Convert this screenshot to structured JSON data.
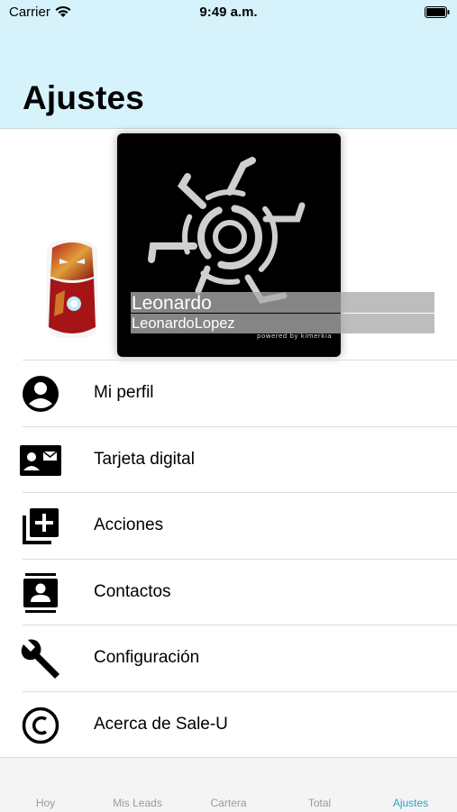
{
  "status_bar": {
    "carrier": "Carrier",
    "time": "9:49 a.m."
  },
  "header": {
    "title": "Ajustes"
  },
  "profile": {
    "name": "Leonardo",
    "username": "LeonardoLopez",
    "cover_caption": "powered by kimerkia"
  },
  "menu": {
    "items": [
      {
        "label": "Mi perfil",
        "icon": "person-circle-icon"
      },
      {
        "label": "Tarjeta digital",
        "icon": "contact-card-icon"
      },
      {
        "label": "Acciones",
        "icon": "add-box-icon"
      },
      {
        "label": "Contactos",
        "icon": "contacts-icon"
      },
      {
        "label": "Configuración",
        "icon": "wrench-icon"
      },
      {
        "label": "Acerca de Sale-U",
        "icon": "copyright-icon"
      }
    ]
  },
  "tab_bar": {
    "tabs": [
      {
        "label": "Hoy"
      },
      {
        "label": "Mis Leads"
      },
      {
        "label": "Cartera"
      },
      {
        "label": "Total"
      },
      {
        "label": "Ajustes"
      }
    ],
    "active_tab": "Ajustes",
    "active_color": "#2fa2c8"
  },
  "colors": {
    "header_bg": "#d6f3fc",
    "accent": "#2fa2c8"
  }
}
